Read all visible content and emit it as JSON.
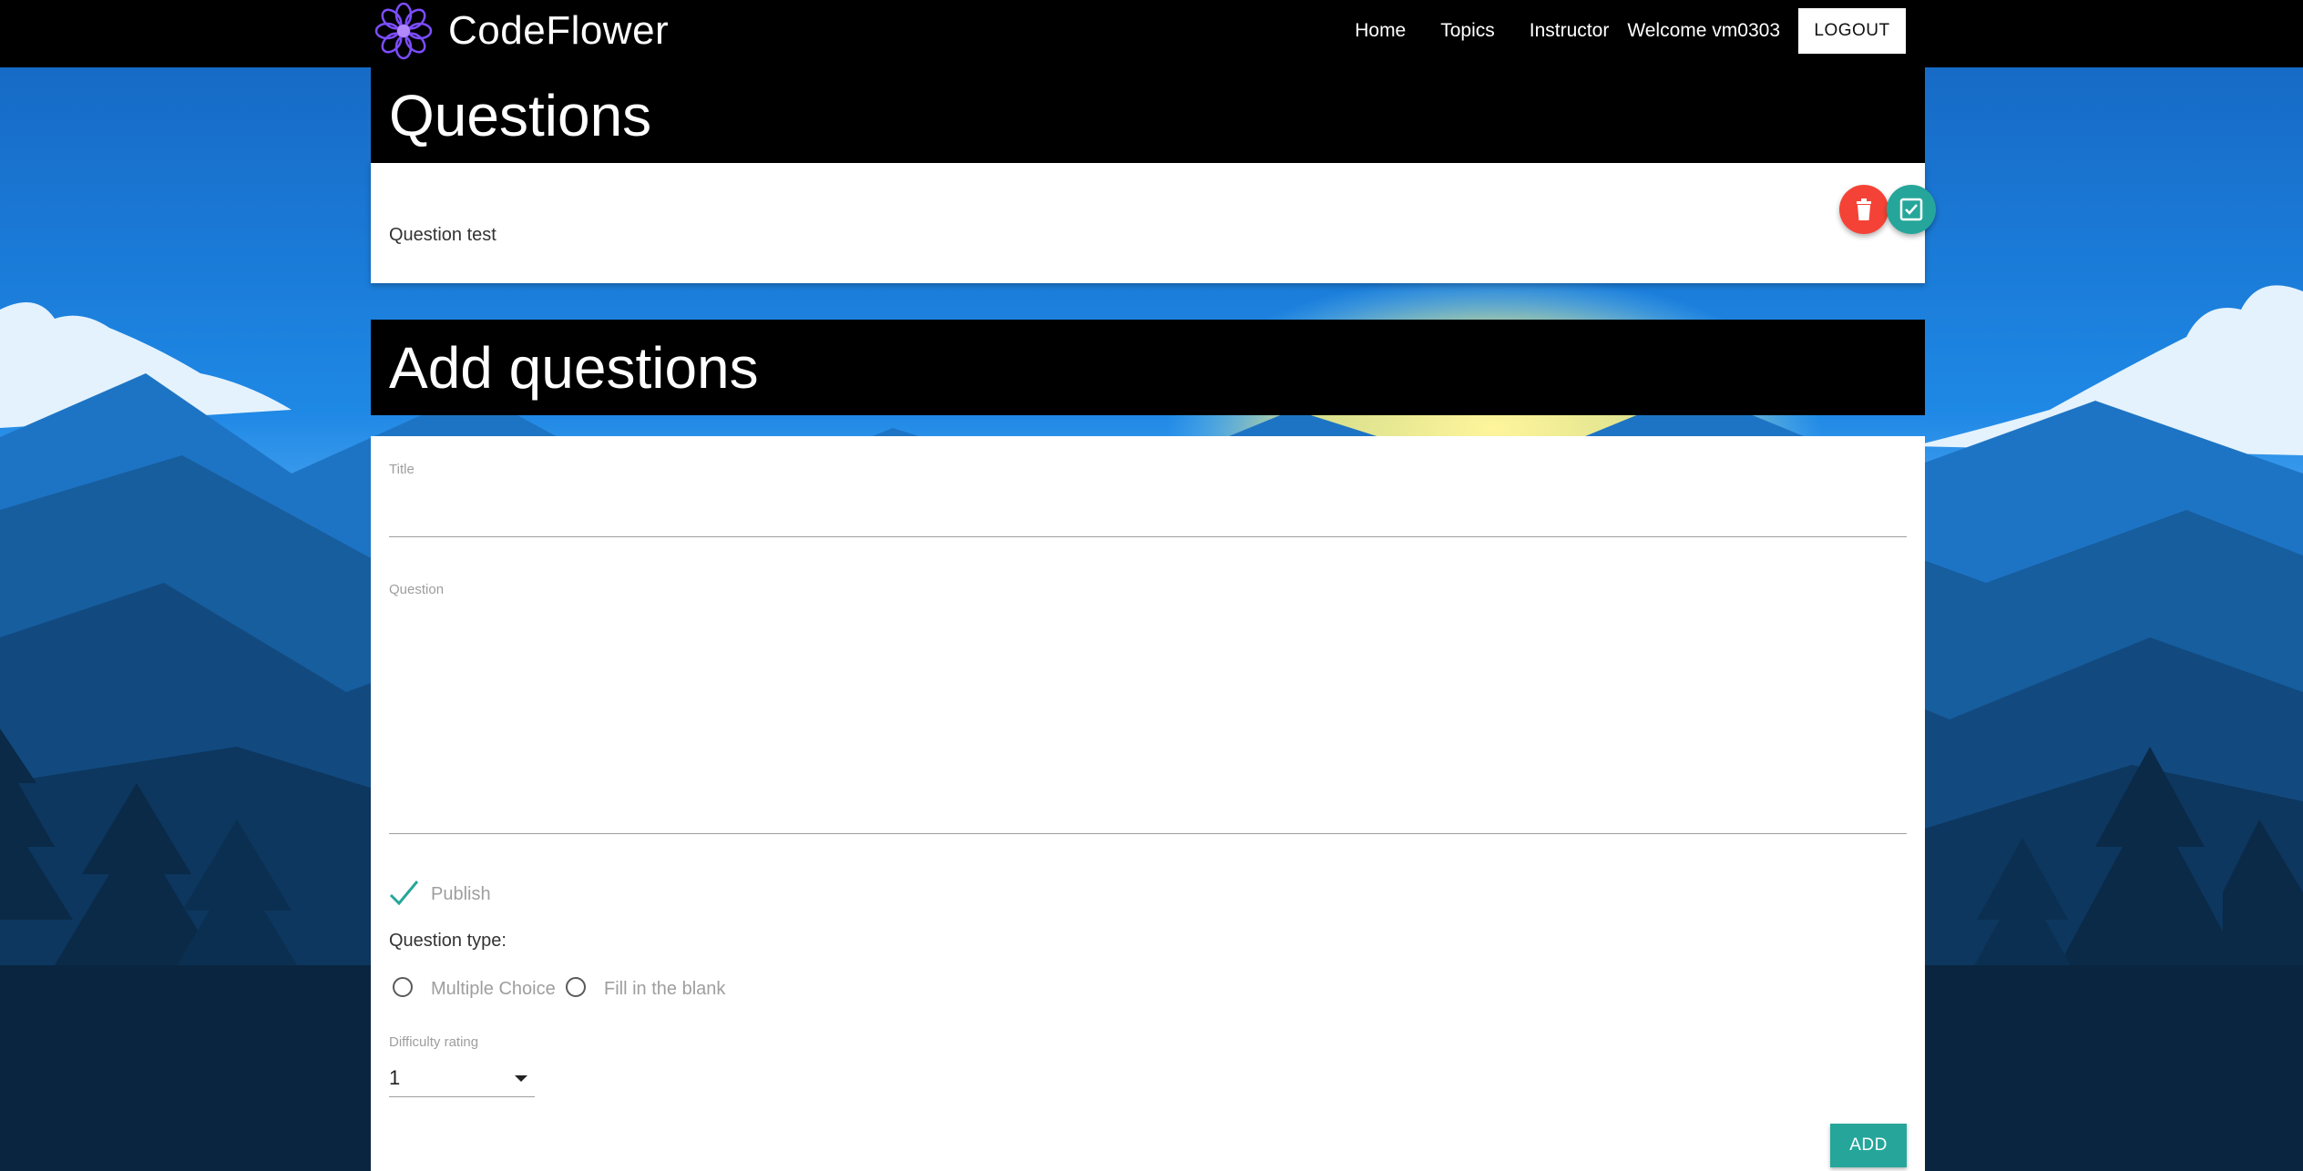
{
  "header": {
    "brand": "CodeFlower",
    "logo_icon": "flower-logo-icon",
    "nav": [
      "Home",
      "Topics",
      "Instructor"
    ],
    "welcome": "Welcome vm0303",
    "logout_label": "LOGOUT"
  },
  "questions_section": {
    "heading": "Questions",
    "items": [
      {
        "title": "Question test",
        "delete_icon": "trash-icon",
        "confirm_icon": "check-box-icon"
      }
    ]
  },
  "add_section": {
    "heading": "Add questions",
    "title_label": "Title",
    "title_value": "",
    "question_label": "Question",
    "question_value": "",
    "publish_label": "Publish",
    "publish_checked": true,
    "question_type_label": "Question type:",
    "question_types": [
      "Multiple Choice",
      "Fill in the blank"
    ],
    "difficulty_label": "Difficulty rating",
    "difficulty_value": "1",
    "add_label": "ADD"
  },
  "colors": {
    "accent": "#26a69a",
    "danger": "#f44336",
    "header_bg": "#000000",
    "logo": "#7c4dff"
  }
}
